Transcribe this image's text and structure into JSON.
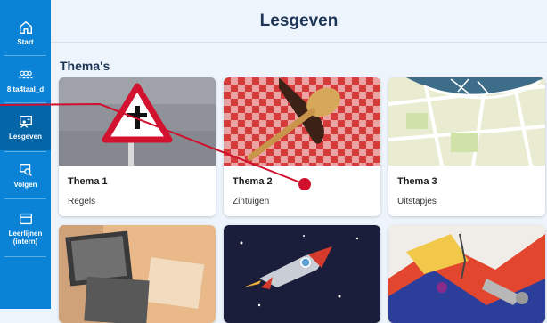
{
  "header": {
    "title": "Lesgeven"
  },
  "sidebar": {
    "items": [
      {
        "label": "Start",
        "icon": "home-icon",
        "active": false
      },
      {
        "label": "8.ta4taal_d",
        "icon": "group-icon",
        "active": false
      },
      {
        "label": "Lesgeven",
        "icon": "teach-icon",
        "active": true
      },
      {
        "label": "Volgen",
        "icon": "monitor-search-icon",
        "active": false
      },
      {
        "label": "Leerlijnen (intern)",
        "icon": "folder-icon",
        "active": false
      }
    ]
  },
  "main": {
    "section_title": "Thema's",
    "cards": [
      {
        "title": "Thema 1",
        "subtitle": "Regels"
      },
      {
        "title": "Thema 2",
        "subtitle": "Zintuigen"
      },
      {
        "title": "Thema 3",
        "subtitle": "Uitstapjes"
      },
      {
        "title": "",
        "subtitle": ""
      },
      {
        "title": "",
        "subtitle": ""
      },
      {
        "title": "",
        "subtitle": ""
      }
    ]
  },
  "colors": {
    "sidebar": "#0a83d6",
    "sidebar_active": "#0465a9",
    "background": "#eef4fb",
    "title": "#1d3557",
    "annotation": "#d0102c"
  }
}
